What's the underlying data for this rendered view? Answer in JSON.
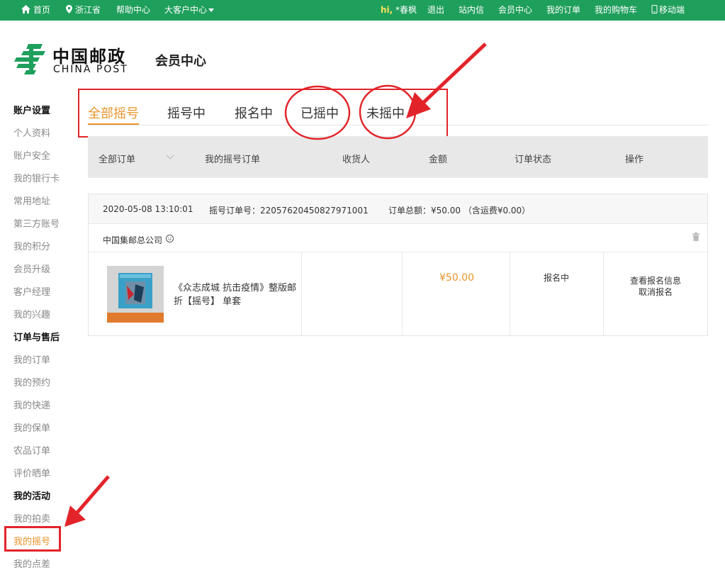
{
  "topbar": {
    "home": "首页",
    "location": "浙江省",
    "help": "帮助中心",
    "bigclient": "大客户中心",
    "greeting_hi": "hi,",
    "username": "*春枫",
    "logout": "退出",
    "messages": "站内信",
    "member_center": "会员中心",
    "my_orders": "我的订单",
    "my_cart": "我的购物车",
    "mobile": "移动端"
  },
  "logo": {
    "cn": "中国邮政",
    "en": "CHINA POST"
  },
  "page_title": "会员中心",
  "sidebar": {
    "account_title": "账户设置",
    "account_items": [
      "个人资料",
      "账户安全",
      "我的银行卡",
      "常用地址",
      "第三方账号",
      "我的积分",
      "会员升级",
      "客户经理",
      "我的兴趣"
    ],
    "orders_title": "订单与售后",
    "orders_items": [
      "我的订单",
      "我的预约",
      "我的快递",
      "我的保单",
      "农品订单",
      "评价晒单"
    ],
    "activity_title": "我的活动",
    "activity_items": [
      "我的拍卖",
      "我的摇号",
      "我的点差"
    ]
  },
  "tabs": [
    "全部摇号",
    "摇号中",
    "报名中",
    "已摇中",
    "未摇中"
  ],
  "table_header": {
    "filter": "全部订单",
    "col_order": "我的摇号订单",
    "col_receiver": "收货人",
    "col_amount": "金额",
    "col_status": "订单状态",
    "col_action": "操作"
  },
  "order": {
    "date": "2020-05-08 13:10:01",
    "number_label": "摇号订单号：",
    "number": "22057620450827971001",
    "total_label": "订单总额：",
    "total": "¥50.00 （含运费¥0.00）",
    "shop": "中国集邮总公司",
    "product_name": "《众志成城 抗击疫情》整版邮折【摇号】 单套",
    "price": "¥50.00",
    "status": "报名中",
    "action_view": "查看报名信息",
    "action_cancel": "取消报名"
  },
  "colors": {
    "brand_green": "#1f9f5c",
    "accent_orange": "#e8952a",
    "annotation_red": "#e2242a"
  }
}
